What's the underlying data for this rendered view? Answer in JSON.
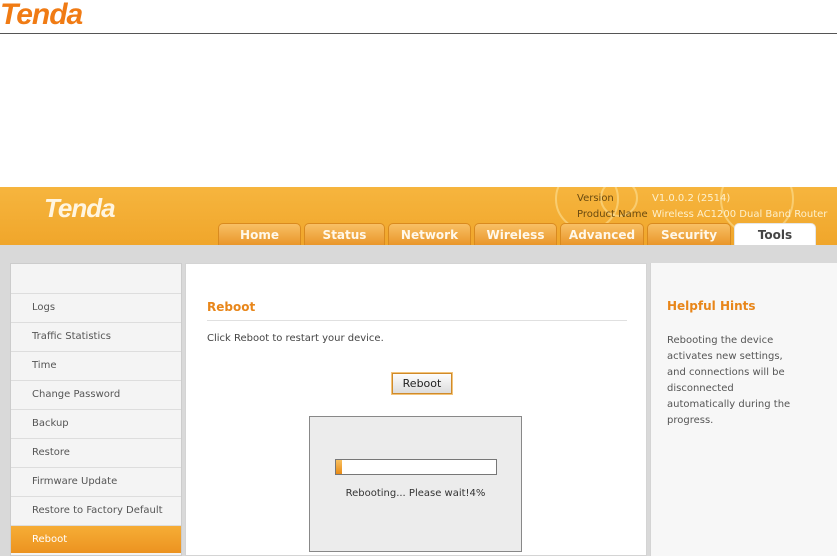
{
  "doc": {
    "logo": "Tenda"
  },
  "banner": {
    "logo": "Tenda",
    "version_label": "Version",
    "version_value": "V1.0.0.2 (2514)",
    "product_label": "Product Name",
    "product_value": "Wireless AC1200 Dual Band Router"
  },
  "tabs": [
    "Home",
    "Status",
    "Network",
    "Wireless",
    "Advanced",
    "Security",
    "Tools"
  ],
  "active_tab": "Tools",
  "sidebar": {
    "items": [
      "Logs",
      "Traffic Statistics",
      "Time",
      "Change Password",
      "Backup",
      "Restore",
      "Firmware Update",
      "Restore to Factory Default",
      "Reboot"
    ],
    "active": "Reboot"
  },
  "main": {
    "title": "Reboot",
    "description": "Click Reboot to restart your device.",
    "button_label": "Reboot"
  },
  "dialog": {
    "progress_percent": 4,
    "status_text": "Rebooting... Please wait!4%"
  },
  "hints": {
    "title": "Helpful Hints",
    "text": "Rebooting the device activates new settings, and connections will be disconnected automatically during the progress."
  },
  "colors": {
    "accent": "#f0a62b",
    "title_orange": "#e8861a",
    "brand_orange": "#f07b14"
  }
}
